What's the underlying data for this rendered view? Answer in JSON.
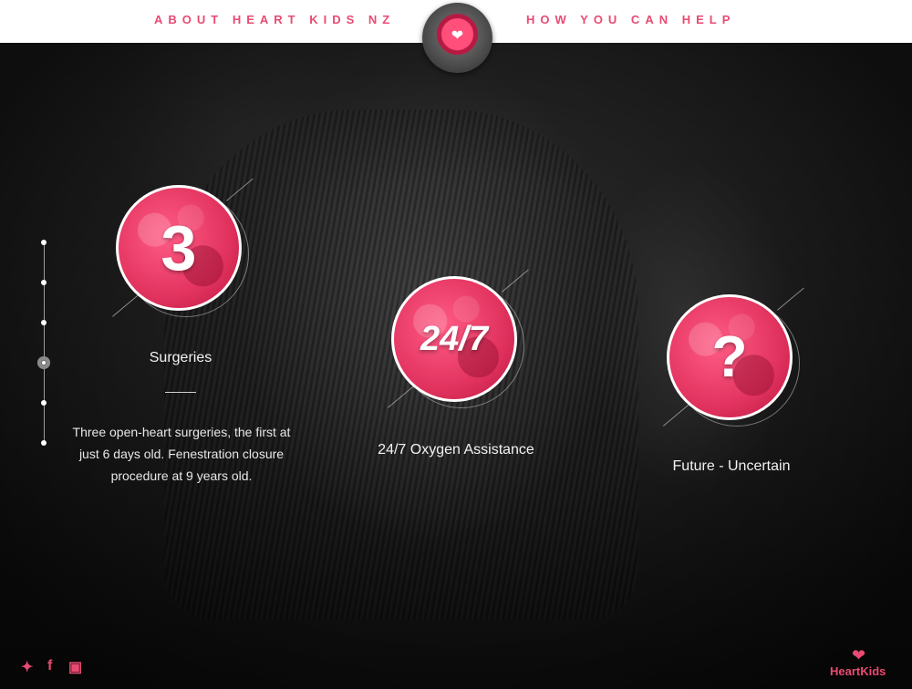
{
  "nav": {
    "about_label": "ABOUT HEART KIDS NZ",
    "help_label": "HOW YOU CAN HELP",
    "logo_icon": "heart-icon"
  },
  "timeline": {
    "dot_count": 6,
    "active_index": 3
  },
  "stats": [
    {
      "value": "3",
      "label": "Surgeries",
      "description": "Three open-heart surgeries, the first at just 6 days old. Fenestration closure procedure at 9 years old."
    },
    {
      "value": "24/7",
      "label": "24/7 Oxygen Assistance"
    },
    {
      "value": "?",
      "label": "Future - Uncertain"
    }
  ],
  "footer": {
    "social": [
      "twitter-icon",
      "facebook-icon",
      "instagram-icon"
    ],
    "brand_name": "HeartKids"
  },
  "colors": {
    "accent": "#e94a72",
    "topbar": "#ffffff"
  }
}
